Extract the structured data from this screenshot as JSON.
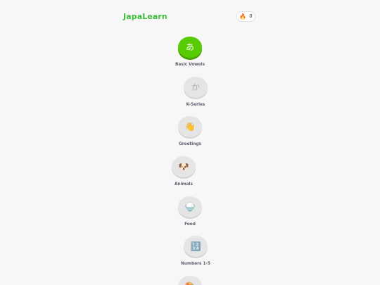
{
  "header": {
    "app_name": "JapaLearn",
    "streak_icon": "fire-icon",
    "streak_count": "0"
  },
  "lessons": [
    {
      "id": "basic-vowels",
      "label": "Basic Vowels",
      "glyph": "あ",
      "state": "active"
    },
    {
      "id": "k-series",
      "label": "K-Series",
      "glyph": "か",
      "state": "locked"
    },
    {
      "id": "greetings",
      "label": "Greetings",
      "glyph": "👋",
      "state": "locked"
    },
    {
      "id": "animals",
      "label": "Animals",
      "glyph": "🐶",
      "state": "locked"
    },
    {
      "id": "food",
      "label": "Food",
      "glyph": "🍚",
      "state": "locked"
    },
    {
      "id": "numbers-1-5",
      "label": "Numbers 1-5",
      "glyph": "🔢",
      "state": "locked"
    },
    {
      "id": "next-lesson",
      "label": "",
      "glyph": "🎨",
      "state": "locked"
    }
  ]
}
